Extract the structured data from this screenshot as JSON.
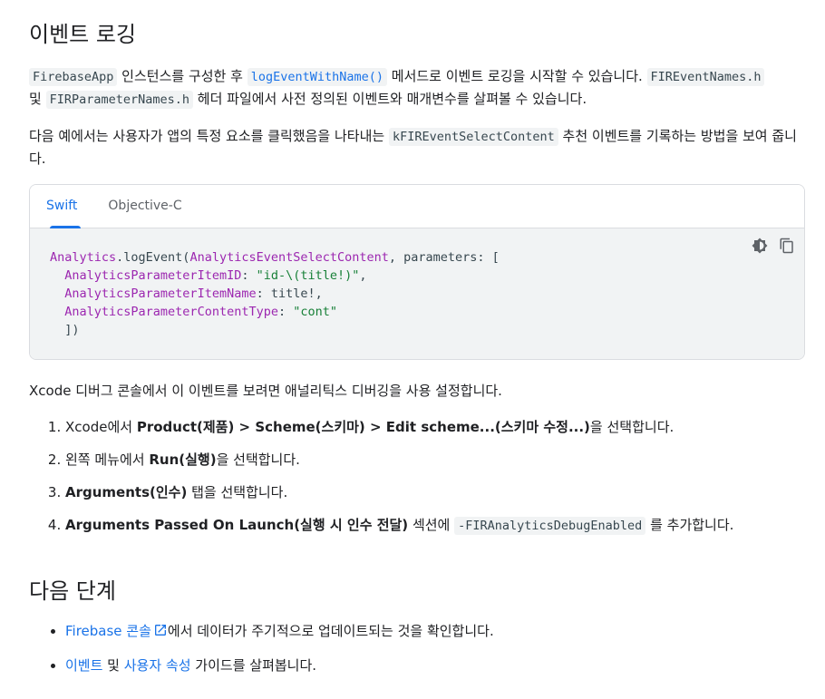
{
  "section1": {
    "title": "이벤트 로깅",
    "para1": {
      "code1": "FirebaseApp",
      "t1": " 인스턴스를 구성한 후 ",
      "link_code": "logEventWithName()",
      "t2": " 메서드로 이벤트 로깅을 시작할 수 있습니다. ",
      "code2": "FIREventNames.h",
      "t3": " 및 ",
      "code3": "FIRParameterNames.h",
      "t4": " 헤더 파일에서 사전 정의된 이벤트와 매개변수를 살펴볼 수 있습니다."
    },
    "para2": {
      "t1": "다음 예에서는 사용자가 앱의 특정 요소를 클릭했음을 나타내는 ",
      "code": "kFIREventSelectContent",
      "t2": " 추천 이벤트를 기록하는 방법을 보여 줍니다."
    }
  },
  "code_block": {
    "tabs": [
      "Swift",
      "Objective-C"
    ],
    "active_tab": "Swift",
    "lines": {
      "l1_type": "Analytics",
      "l1_a": ".logEvent(",
      "l1_type2": "AnalyticsEventSelectContent",
      "l1_b": ", parameters: [",
      "l2_type": "AnalyticsParameterItemID",
      "l2_a": ": ",
      "l2_str": "\"id-\\(title!)\"",
      "l2_b": ",",
      "l3_type": "AnalyticsParameterItemName",
      "l3_a": ": title!,",
      "l4_type": "AnalyticsParameterContentType",
      "l4_a": ": ",
      "l4_str": "\"cont\"",
      "l5": "])"
    },
    "icons": [
      "theme-toggle-icon",
      "copy-icon"
    ]
  },
  "debug_intro": "Xcode 디버그 콘솔에서 이 이벤트를 보려면 애널리틱스 디버깅을 사용 설정합니다.",
  "steps": [
    {
      "pre": "Xcode에서 ",
      "bold": "Product(제품) > Scheme(스키마) > Edit scheme...(스키마 수정...)",
      "post": "을 선택합니다."
    },
    {
      "pre": "왼쪽 메뉴에서 ",
      "bold": "Run(실행)",
      "post": "을 선택합니다."
    },
    {
      "pre": "",
      "bold": "Arguments(인수)",
      "post": " 탭을 선택합니다."
    },
    {
      "pre": "",
      "bold": "Arguments Passed On Launch(실행 시 인수 전달)",
      "post": " 섹션에 ",
      "code": "-FIRAnalyticsDebugEnabled",
      "post2": " 를 추가합니다."
    }
  ],
  "section2": {
    "title": "다음 단계",
    "bullets": [
      {
        "link": "Firebase 콘솔",
        "post": "에서 데이터가 주기적으로 업데이트되는 것을 확인합니다."
      },
      {
        "link1": "이벤트",
        "mid": " 및 ",
        "link2": "사용자 속성",
        "post": " 가이드를 살펴봅니다."
      }
    ]
  },
  "colors": {
    "link": "#1a73e8",
    "code_bg": "#f1f3f4",
    "type": "#9c27b0",
    "string": "#188038"
  }
}
